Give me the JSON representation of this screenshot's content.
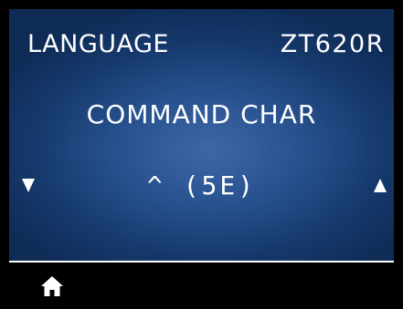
{
  "header": {
    "title": "LANGUAGE",
    "model": "ZT620R"
  },
  "setting": {
    "name": "COMMAND CHAR",
    "value": "^ (5E)"
  },
  "navigation": {
    "prev_icon": "triangle-down-icon",
    "next_icon": "triangle-up-icon"
  },
  "footer": {
    "home_icon": "home-icon"
  },
  "colors": {
    "background_center": "#3d68a6",
    "background_edge": "#0f2c57",
    "text": "#ffffff",
    "bezel": "#000000"
  }
}
